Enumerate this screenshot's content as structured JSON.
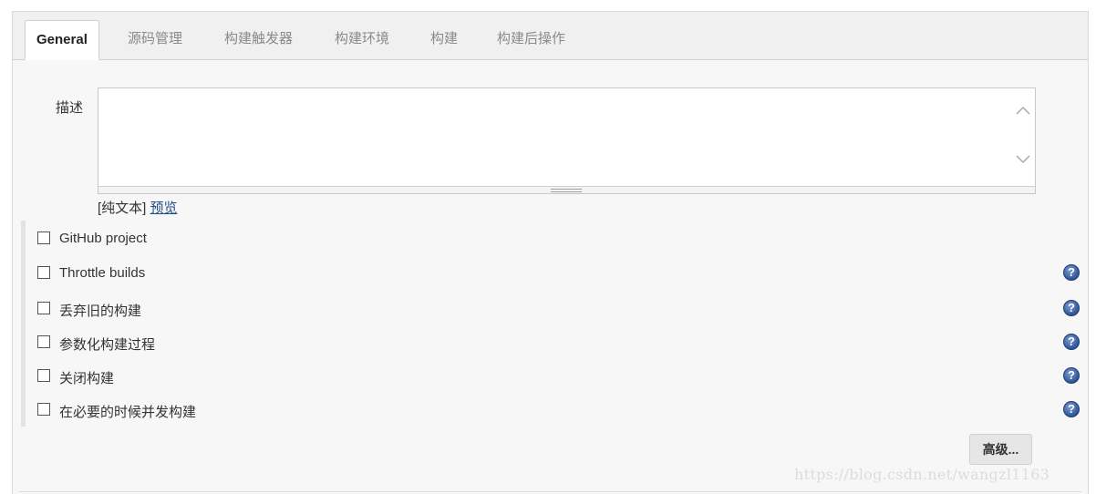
{
  "tabs": [
    {
      "label": "General",
      "active": true
    },
    {
      "label": "源码管理",
      "active": false
    },
    {
      "label": "构建触发器",
      "active": false
    },
    {
      "label": "构建环境",
      "active": false
    },
    {
      "label": "构建",
      "active": false
    },
    {
      "label": "构建后操作",
      "active": false
    }
  ],
  "description": {
    "label": "描述",
    "value": "",
    "format_prefix": "[纯文本]",
    "preview_link": "预览"
  },
  "options": [
    {
      "label": "GitHub project",
      "checked": false,
      "has_help": false
    },
    {
      "label": "Throttle builds",
      "checked": false,
      "has_help": true
    },
    {
      "label": "丢弃旧的构建",
      "checked": false,
      "has_help": true
    },
    {
      "label": "参数化构建过程",
      "checked": false,
      "has_help": true
    },
    {
      "label": "关闭构建",
      "checked": false,
      "has_help": true
    },
    {
      "label": "在必要的时候并发构建",
      "checked": false,
      "has_help": true
    }
  ],
  "help_icon_glyph": "?",
  "advanced_button": "高级...",
  "watermark": "https://blog.csdn.net/wangzl1163",
  "colors": {
    "link": "#204a87",
    "help_icon": "#2f5597",
    "panel_bg": "#f7f7f7"
  }
}
